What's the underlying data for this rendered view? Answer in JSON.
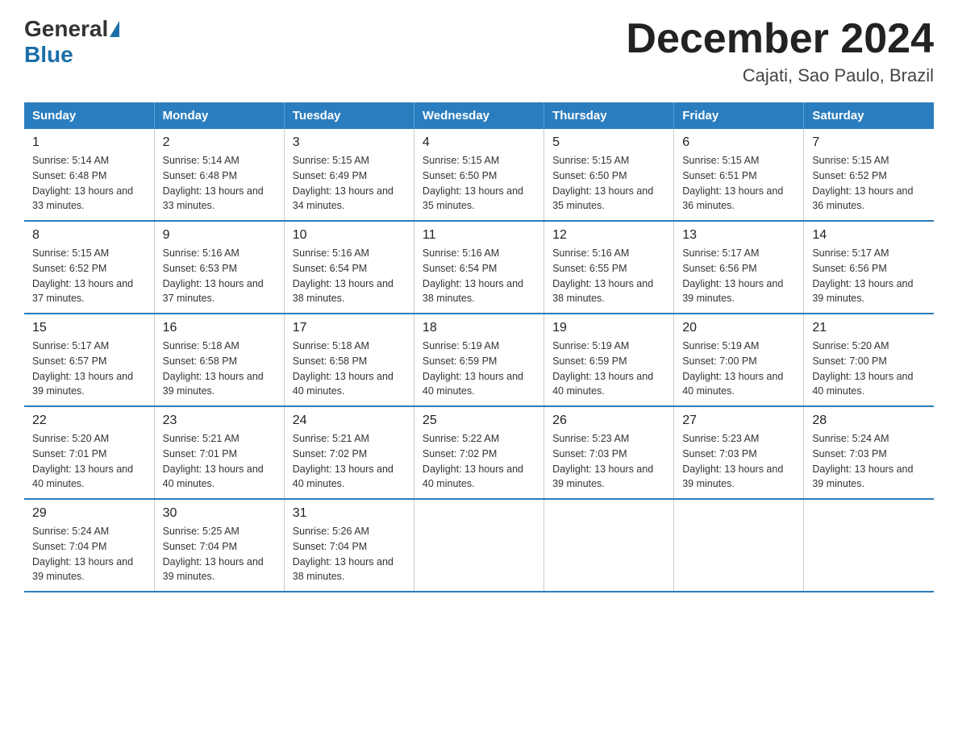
{
  "logo": {
    "general": "General",
    "blue": "Blue"
  },
  "title": "December 2024",
  "subtitle": "Cajati, Sao Paulo, Brazil",
  "days_of_week": [
    "Sunday",
    "Monday",
    "Tuesday",
    "Wednesday",
    "Thursday",
    "Friday",
    "Saturday"
  ],
  "weeks": [
    [
      {
        "day": "1",
        "sunrise": "5:14 AM",
        "sunset": "6:48 PM",
        "daylight": "13 hours and 33 minutes."
      },
      {
        "day": "2",
        "sunrise": "5:14 AM",
        "sunset": "6:48 PM",
        "daylight": "13 hours and 33 minutes."
      },
      {
        "day": "3",
        "sunrise": "5:15 AM",
        "sunset": "6:49 PM",
        "daylight": "13 hours and 34 minutes."
      },
      {
        "day": "4",
        "sunrise": "5:15 AM",
        "sunset": "6:50 PM",
        "daylight": "13 hours and 35 minutes."
      },
      {
        "day": "5",
        "sunrise": "5:15 AM",
        "sunset": "6:50 PM",
        "daylight": "13 hours and 35 minutes."
      },
      {
        "day": "6",
        "sunrise": "5:15 AM",
        "sunset": "6:51 PM",
        "daylight": "13 hours and 36 minutes."
      },
      {
        "day": "7",
        "sunrise": "5:15 AM",
        "sunset": "6:52 PM",
        "daylight": "13 hours and 36 minutes."
      }
    ],
    [
      {
        "day": "8",
        "sunrise": "5:15 AM",
        "sunset": "6:52 PM",
        "daylight": "13 hours and 37 minutes."
      },
      {
        "day": "9",
        "sunrise": "5:16 AM",
        "sunset": "6:53 PM",
        "daylight": "13 hours and 37 minutes."
      },
      {
        "day": "10",
        "sunrise": "5:16 AM",
        "sunset": "6:54 PM",
        "daylight": "13 hours and 38 minutes."
      },
      {
        "day": "11",
        "sunrise": "5:16 AM",
        "sunset": "6:54 PM",
        "daylight": "13 hours and 38 minutes."
      },
      {
        "day": "12",
        "sunrise": "5:16 AM",
        "sunset": "6:55 PM",
        "daylight": "13 hours and 38 minutes."
      },
      {
        "day": "13",
        "sunrise": "5:17 AM",
        "sunset": "6:56 PM",
        "daylight": "13 hours and 39 minutes."
      },
      {
        "day": "14",
        "sunrise": "5:17 AM",
        "sunset": "6:56 PM",
        "daylight": "13 hours and 39 minutes."
      }
    ],
    [
      {
        "day": "15",
        "sunrise": "5:17 AM",
        "sunset": "6:57 PM",
        "daylight": "13 hours and 39 minutes."
      },
      {
        "day": "16",
        "sunrise": "5:18 AM",
        "sunset": "6:58 PM",
        "daylight": "13 hours and 39 minutes."
      },
      {
        "day": "17",
        "sunrise": "5:18 AM",
        "sunset": "6:58 PM",
        "daylight": "13 hours and 40 minutes."
      },
      {
        "day": "18",
        "sunrise": "5:19 AM",
        "sunset": "6:59 PM",
        "daylight": "13 hours and 40 minutes."
      },
      {
        "day": "19",
        "sunrise": "5:19 AM",
        "sunset": "6:59 PM",
        "daylight": "13 hours and 40 minutes."
      },
      {
        "day": "20",
        "sunrise": "5:19 AM",
        "sunset": "7:00 PM",
        "daylight": "13 hours and 40 minutes."
      },
      {
        "day": "21",
        "sunrise": "5:20 AM",
        "sunset": "7:00 PM",
        "daylight": "13 hours and 40 minutes."
      }
    ],
    [
      {
        "day": "22",
        "sunrise": "5:20 AM",
        "sunset": "7:01 PM",
        "daylight": "13 hours and 40 minutes."
      },
      {
        "day": "23",
        "sunrise": "5:21 AM",
        "sunset": "7:01 PM",
        "daylight": "13 hours and 40 minutes."
      },
      {
        "day": "24",
        "sunrise": "5:21 AM",
        "sunset": "7:02 PM",
        "daylight": "13 hours and 40 minutes."
      },
      {
        "day": "25",
        "sunrise": "5:22 AM",
        "sunset": "7:02 PM",
        "daylight": "13 hours and 40 minutes."
      },
      {
        "day": "26",
        "sunrise": "5:23 AM",
        "sunset": "7:03 PM",
        "daylight": "13 hours and 39 minutes."
      },
      {
        "day": "27",
        "sunrise": "5:23 AM",
        "sunset": "7:03 PM",
        "daylight": "13 hours and 39 minutes."
      },
      {
        "day": "28",
        "sunrise": "5:24 AM",
        "sunset": "7:03 PM",
        "daylight": "13 hours and 39 minutes."
      }
    ],
    [
      {
        "day": "29",
        "sunrise": "5:24 AM",
        "sunset": "7:04 PM",
        "daylight": "13 hours and 39 minutes."
      },
      {
        "day": "30",
        "sunrise": "5:25 AM",
        "sunset": "7:04 PM",
        "daylight": "13 hours and 39 minutes."
      },
      {
        "day": "31",
        "sunrise": "5:26 AM",
        "sunset": "7:04 PM",
        "daylight": "13 hours and 38 minutes."
      },
      null,
      null,
      null,
      null
    ]
  ]
}
